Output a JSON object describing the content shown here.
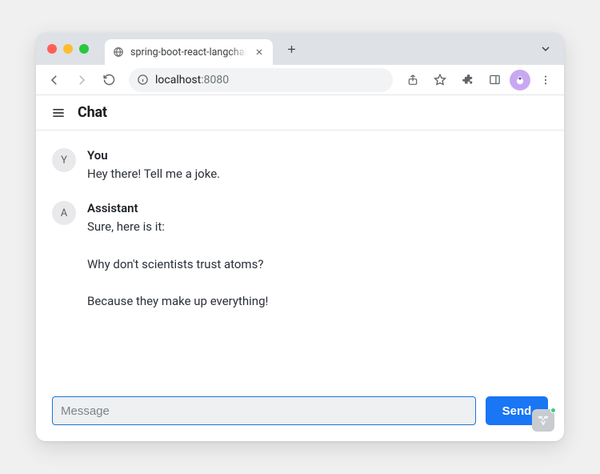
{
  "browser": {
    "tab_title": "spring-boot-react-langchain-c",
    "address": {
      "host": "localhost",
      "path": ":8080"
    }
  },
  "app": {
    "title": "Chat"
  },
  "messages": [
    {
      "avatar": "Y",
      "name": "You",
      "text": "Hey there! Tell me a joke."
    },
    {
      "avatar": "A",
      "name": "Assistant",
      "text": "Sure, here is it:\n\nWhy don't scientists trust atoms?\n\nBecause they make up everything!"
    }
  ],
  "composer": {
    "placeholder": "Message",
    "value": "",
    "send_label": "Send"
  }
}
